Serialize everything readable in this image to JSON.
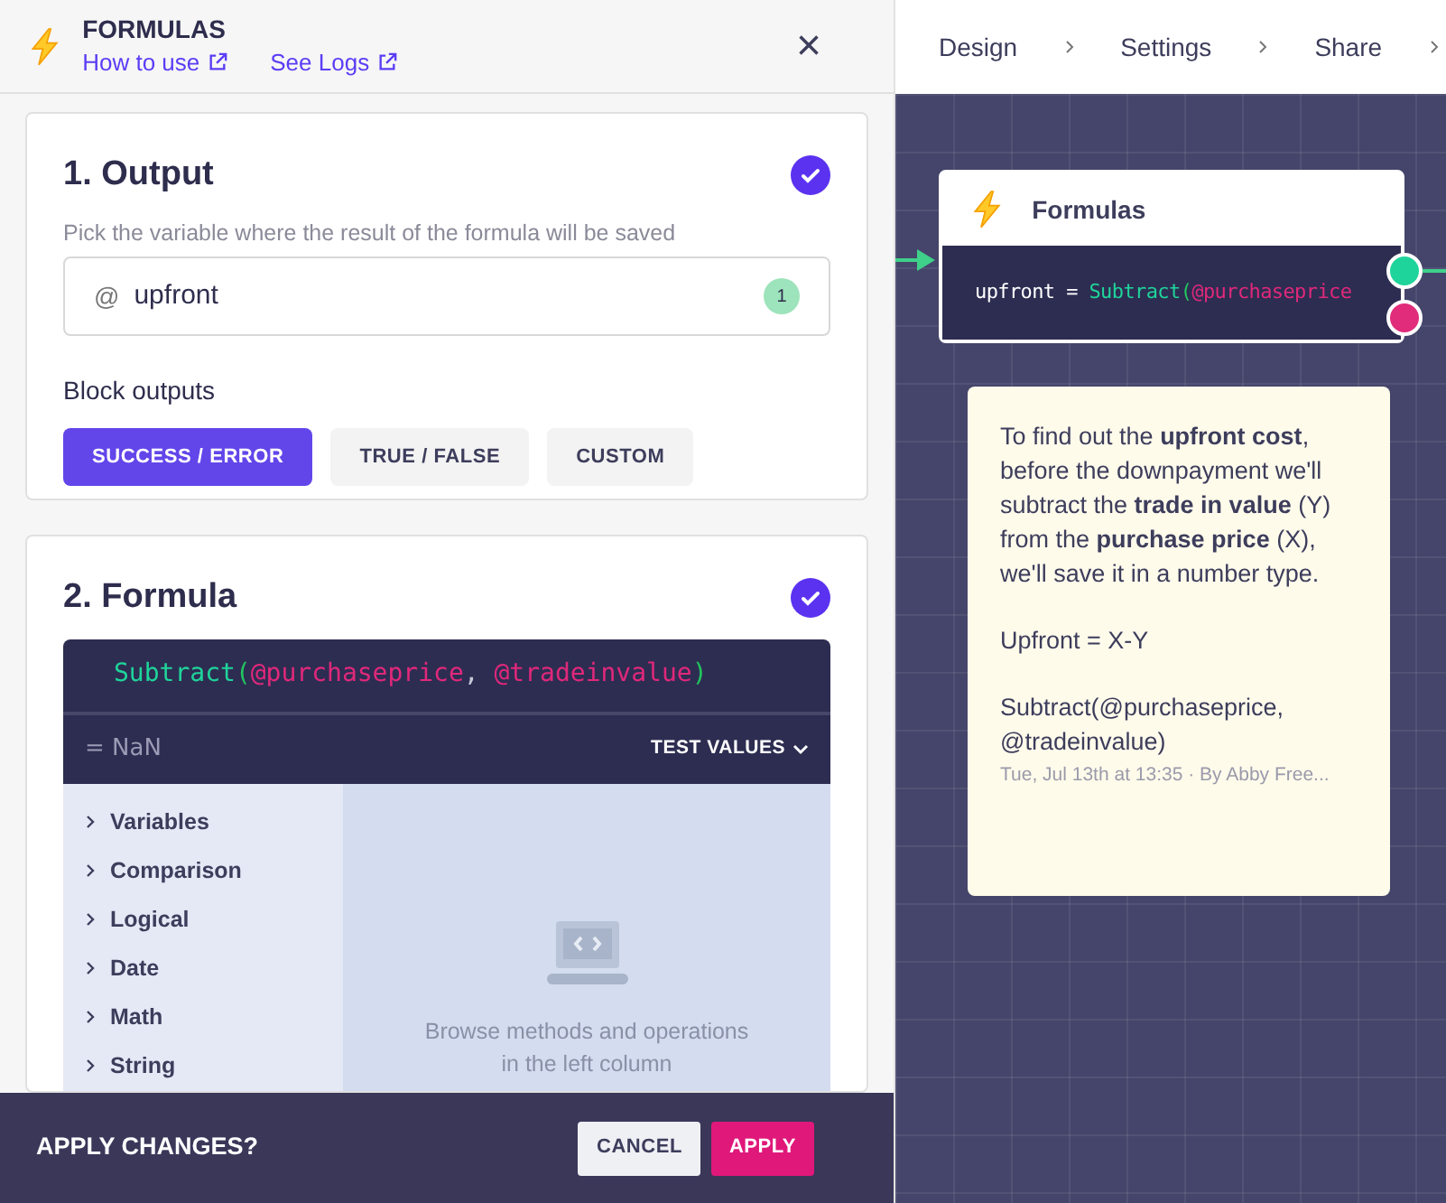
{
  "panel": {
    "title": "FORMULAS",
    "links": [
      "How to use",
      "See Logs"
    ],
    "close": "×"
  },
  "output_section": {
    "title": "1. Output",
    "done": true,
    "hint": "Pick the variable where the result of the formula will be saved",
    "variable": {
      "prefix": "@",
      "value": "upfront",
      "badge": "1"
    },
    "outputs_label": "Block outputs",
    "options": [
      {
        "label": "SUCCESS / ERROR",
        "selected": true
      },
      {
        "label": "TRUE / FALSE",
        "selected": false
      },
      {
        "label": "CUSTOM",
        "selected": false
      }
    ]
  },
  "formula_section": {
    "title": "2. Formula",
    "done": true,
    "tokens": [
      {
        "kind": "func",
        "text": "Subtract"
      },
      {
        "kind": "paren",
        "text": "("
      },
      {
        "kind": "var",
        "text": "@purchaseprice"
      },
      {
        "kind": "punct",
        "text": ", "
      },
      {
        "kind": "var",
        "text": "@tradeinvalue"
      },
      {
        "kind": "paren",
        "text": ")"
      }
    ],
    "result": "= NaN",
    "test_values": "TEST VALUES",
    "categories": [
      {
        "label": "Variables",
        "expanded": false
      },
      {
        "label": "Comparison",
        "expanded": false
      },
      {
        "label": "Logical",
        "expanded": false
      },
      {
        "label": "Date",
        "expanded": false
      },
      {
        "label": "Math",
        "expanded": false
      },
      {
        "label": "String",
        "expanded": false
      }
    ],
    "empty_text": "Browse methods and operations in the left column"
  },
  "footer": {
    "question": "APPLY CHANGES?",
    "buttons": [
      {
        "label": "CANCEL",
        "kind": "secondary"
      },
      {
        "label": "APPLY",
        "kind": "primary"
      }
    ]
  },
  "breadcrumbs": [
    "Design",
    "Settings",
    "Share"
  ],
  "node": {
    "title": "Formulas",
    "tokens": [
      {
        "kind": "plain",
        "text": "upfront = "
      },
      {
        "kind": "func",
        "text": "Subtract"
      },
      {
        "kind": "paren",
        "text": "("
      },
      {
        "kind": "var",
        "text": "@purchaseprice"
      }
    ]
  },
  "note": {
    "paragraphs": [
      "To find out the **upfront cost**, before the downpayment we'll subtract the **trade in value** (Y) from the **purchase price** (X), we'll save it in a number type.",
      "Upfront = X-Y",
      "Subtract(@purchaseprice, @tradeinvalue)"
    ],
    "meta": "Tue, Jul 13th at 13:35 · By Abby Free..."
  }
}
